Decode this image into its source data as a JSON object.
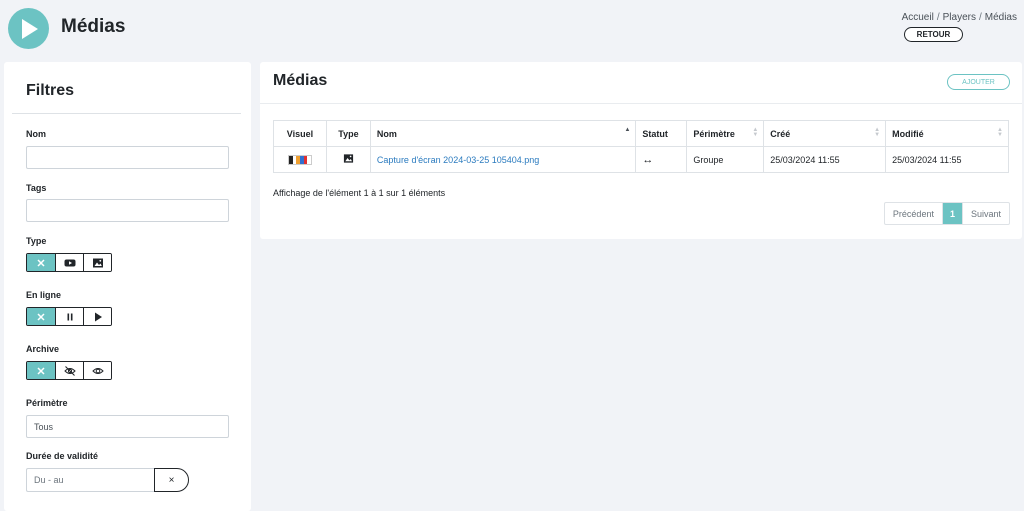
{
  "header": {
    "title": "Médias",
    "breadcrumb": [
      "Accueil",
      "Players",
      "Médias"
    ],
    "back_label": "RETOUR"
  },
  "filters": {
    "title": "Filtres",
    "name_label": "Nom",
    "name_value": "",
    "tags_label": "Tags",
    "tags_value": "",
    "type_label": "Type",
    "online_label": "En ligne",
    "archive_label": "Archive",
    "perimeter_label": "Périmètre",
    "perimeter_value": "Tous",
    "validity_label": "Durée de validité",
    "validity_placeholder": "Du - au",
    "clear_glyph": "×"
  },
  "media": {
    "title": "Médias",
    "add_label": "AJOUTER",
    "columns": [
      "Visuel",
      "Type",
      "Nom",
      "Statut",
      "Périmètre",
      "Créé",
      "Modifié"
    ],
    "rows": [
      {
        "name": "Capture d'écran 2024-03-25 105404.png",
        "status_glyph": "↔",
        "perimeter": "Groupe",
        "created": "25/03/2024 11:55",
        "modified": "25/03/2024 11:55"
      }
    ],
    "info": "Affichage de l'élément 1 à 1 sur 1 éléments",
    "pagination": {
      "prev": "Précédent",
      "current": "1",
      "next": "Suivant"
    }
  },
  "colors": {
    "accent": "#6cc3c3",
    "link": "#2b7bbf",
    "background": "#f1f3f7"
  }
}
